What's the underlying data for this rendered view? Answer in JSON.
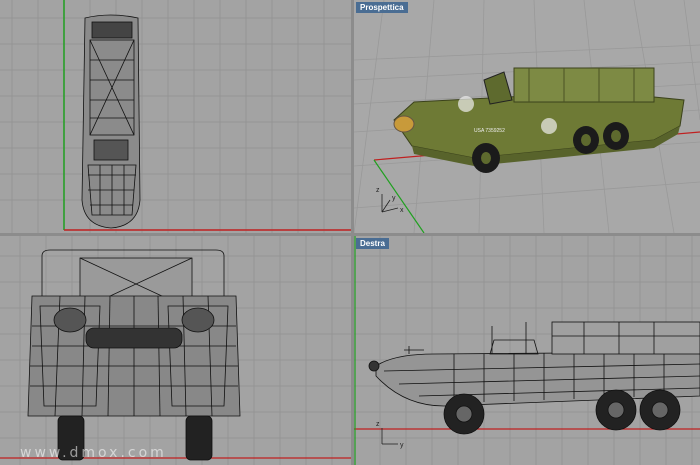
{
  "viewports": {
    "top": {
      "label": ""
    },
    "perspective": {
      "label": "Prospettica",
      "axes": {
        "x": "x",
        "y": "y",
        "z": "z"
      }
    },
    "front": {
      "label": ""
    },
    "right": {
      "label": "Destra",
      "axes": {
        "y": "y",
        "z": "z"
      }
    }
  },
  "vehicle": {
    "hull_text": "USA 7359252"
  },
  "colors": {
    "viewport_bg": "#a3a3a3",
    "grid": "#959595",
    "axis_x": "#c02020",
    "axis_y": "#20a020",
    "label_bg": "#4a6d93",
    "hull": "#6e7a35"
  },
  "watermark": "www.dmox.com"
}
